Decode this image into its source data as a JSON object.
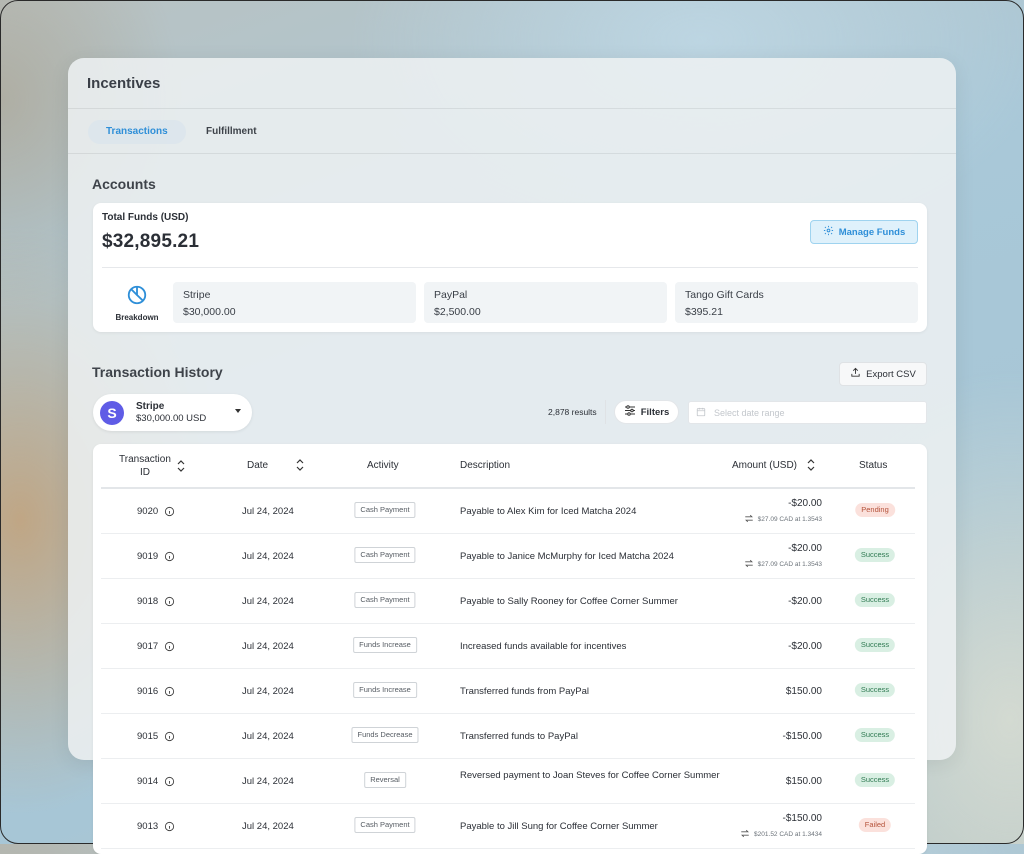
{
  "app": {
    "title": "Incentives",
    "tabs": [
      {
        "label": "Transactions",
        "active": true
      },
      {
        "label": "Fulfillment",
        "active": false
      }
    ]
  },
  "accounts": {
    "section_title": "Accounts",
    "total_label": "Total Funds (USD)",
    "total_value": "$32,895.21",
    "manage_label": "Manage Funds",
    "breakdown_label": "Breakdown",
    "items": [
      {
        "name": "Stripe",
        "value": "$30,000.00"
      },
      {
        "name": "PayPal",
        "value": "$2,500.00"
      },
      {
        "name": "Tango Gift Cards",
        "value": "$395.21"
      }
    ]
  },
  "history": {
    "section_title": "Transaction History",
    "export_label": "Export CSV",
    "selected_account": {
      "name": "Stripe",
      "balance": "$30,000.00 USD",
      "logo_letter": "S"
    },
    "results": "2,878 results",
    "filters_label": "Filters",
    "date_placeholder": "Select date range"
  },
  "table": {
    "columns": {
      "id_line1": "Transaction",
      "id_line2": "ID",
      "date": "Date",
      "activity": "Activity",
      "description": "Description",
      "amount": "Amount (USD)",
      "status": "Status"
    },
    "rows": [
      {
        "id": "9020",
        "date": "Jul 24, 2024",
        "activity": "Cash Payment",
        "description": "Payable to Alex Kim for Iced Matcha 2024",
        "amount": "-$20.00",
        "conversion": "$27.09 CAD at 1.3543",
        "status": "Pending"
      },
      {
        "id": "9019",
        "date": "Jul 24, 2024",
        "activity": "Cash Payment",
        "description": "Payable to Janice McMurphy for Iced Matcha 2024",
        "amount": "-$20.00",
        "conversion": "$27.09 CAD at 1.3543",
        "status": "Success"
      },
      {
        "id": "9018",
        "date": "Jul 24, 2024",
        "activity": "Cash Payment",
        "description": "Payable to Sally Rooney for Coffee Corner Summer",
        "amount": "-$20.00",
        "conversion": "",
        "status": "Success"
      },
      {
        "id": "9017",
        "date": "Jul 24, 2024",
        "activity": "Funds Increase",
        "description": "Increased funds available for incentives",
        "amount": "-$20.00",
        "conversion": "",
        "status": "Success"
      },
      {
        "id": "9016",
        "date": "Jul 24, 2024",
        "activity": "Funds Increase",
        "description": "Transferred funds from PayPal",
        "amount": "$150.00",
        "conversion": "",
        "status": "Success"
      },
      {
        "id": "9015",
        "date": "Jul 24, 2024",
        "activity": "Funds Decrease",
        "description": "Transferred funds to PayPal",
        "amount": "-$150.00",
        "conversion": "",
        "status": "Success"
      },
      {
        "id": "9014",
        "date": "Jul 24, 2024",
        "activity": "Reversal",
        "description": "Reversed payment to Joan Steves for Coffee Corner Summer",
        "amount": "$150.00",
        "conversion": "",
        "status": "Success"
      },
      {
        "id": "9013",
        "date": "Jul 24, 2024",
        "activity": "Cash Payment",
        "description": "Payable to Jill Sung for Coffee Corner Summer",
        "amount": "-$150.00",
        "conversion": "$201.52 CAD at 1.3434",
        "status": "Failed"
      }
    ]
  },
  "colors": {
    "accent": "#2f8fd8",
    "stripe": "#5f5ce6",
    "success_bg": "#d9efe3",
    "pending_bg": "#fbe1dc"
  }
}
